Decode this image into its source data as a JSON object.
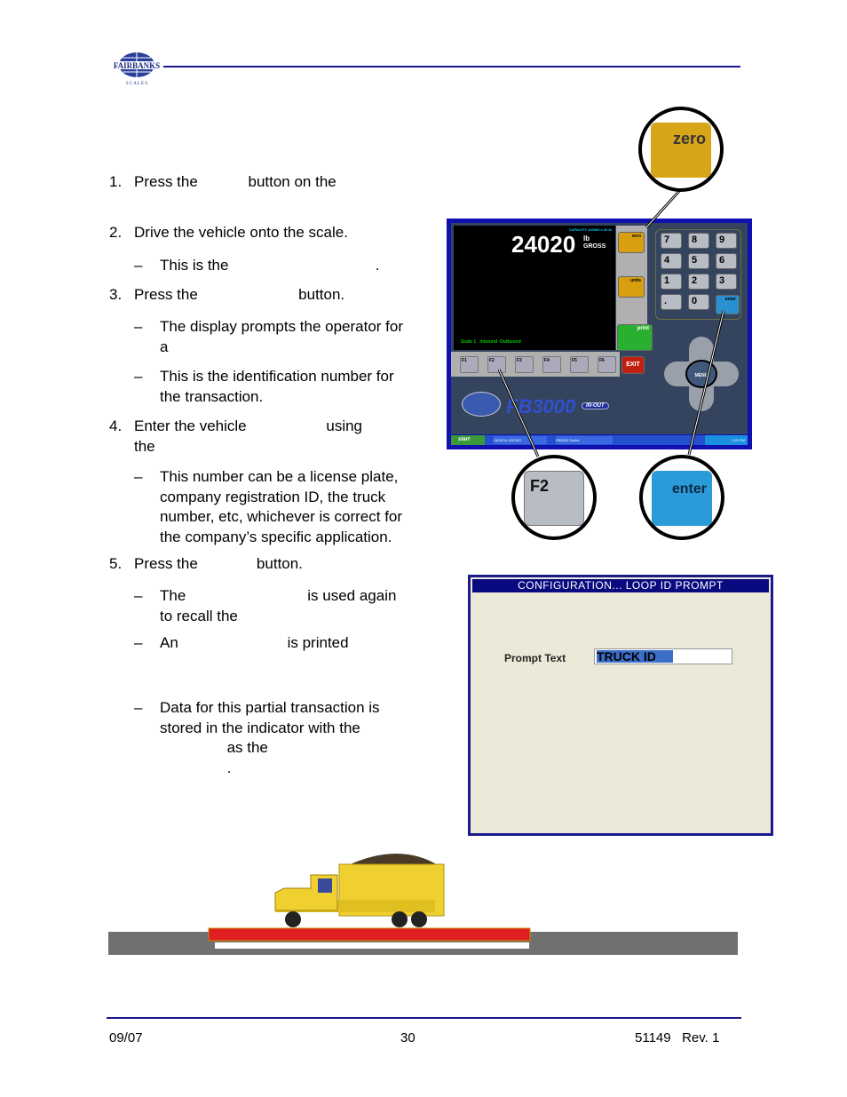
{
  "header": {
    "logo_text": "FAIRBANKS",
    "logo_sub": "SCALES"
  },
  "steps": [
    {
      "num": "1.",
      "lines": [
        "Press the            button on the"
      ]
    },
    {
      "num": "2.",
      "lines": [
        "Drive the vehicle onto the scale."
      ]
    },
    {
      "sub": true,
      "lines": [
        "This is the                                   ."
      ]
    },
    {
      "num": "3.",
      "lines": [
        "Press the                        button."
      ]
    },
    {
      "sub": true,
      "lines": [
        "The display prompts the operator for",
        "a"
      ]
    },
    {
      "sub": true,
      "lines": [
        "This is the identification number for",
        "the transaction."
      ]
    },
    {
      "num": "4.",
      "lines": [
        "Enter the vehicle                   using",
        "the"
      ]
    },
    {
      "sub": true,
      "lines": [
        "This number can be a license plate,",
        "company registration ID, the truck",
        "number, etc, whichever is correct for",
        "the company’s specific application."
      ]
    },
    {
      "num": "5.",
      "lines": [
        "Press the              button."
      ]
    },
    {
      "sub": true,
      "lines": [
        "The                             is used again",
        "to recall the"
      ]
    },
    {
      "sub": true,
      "lines": [
        "An                          is printed"
      ]
    },
    {
      "sub": true,
      "lines": [
        "Data for this partial transaction is",
        "stored in the indicator with the",
        "                as the",
        "                ."
      ]
    }
  ],
  "dash": "–",
  "indicator": {
    "weight": "24020",
    "unit": "lb",
    "mode": "GROSS",
    "capacity": "CAPACITY 120000 x 20 lb",
    "status": "Scale 1   Inbound  Outbound",
    "zero": "zero",
    "units": "units",
    "print": "print",
    "exit": "EXIT",
    "menu": "MENU",
    "enter": "enter",
    "keys": [
      "7",
      "8",
      "9",
      "4",
      "5",
      "6",
      "1",
      "2",
      "3",
      ".",
      "0"
    ],
    "fkeys": [
      "F1",
      "F2",
      "F3",
      "F4",
      "F5",
      "F6"
    ],
    "brand": "FB3000",
    "badge": "IN-OUT",
    "taskbar": {
      "start": "start",
      "item1": "24020 lb GROSS",
      "item2": "FB3000 Series",
      "clock": "1:20 PM"
    }
  },
  "callouts": {
    "zero": "zero",
    "f2": "F2",
    "enter": "enter"
  },
  "dialog": {
    "title": "CONFIGURATION...  LOOP ID PROMPT",
    "label": "Prompt Text",
    "value": "TRUCK ID"
  },
  "footer": {
    "date": "09/07",
    "page": "30",
    "doc": "51149   Rev. 1"
  }
}
